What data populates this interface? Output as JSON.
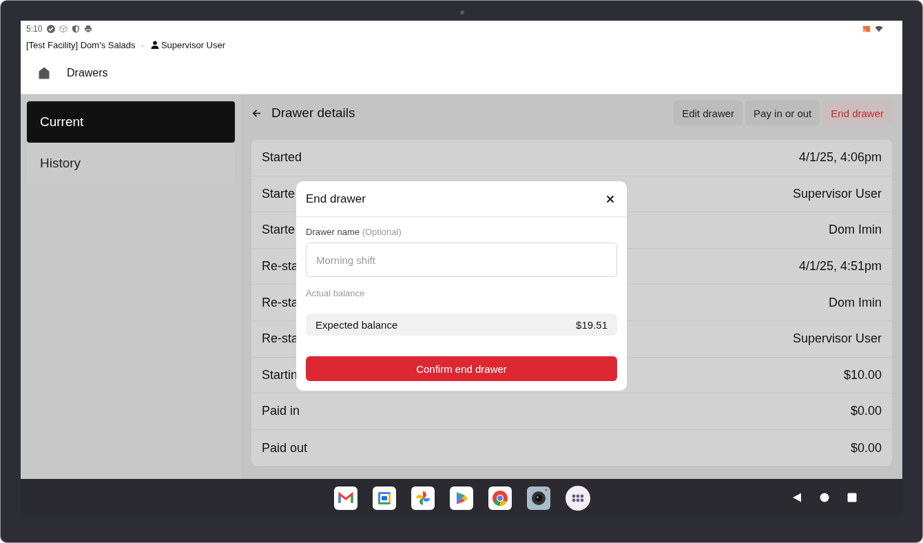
{
  "status_bar": {
    "time": "5:10"
  },
  "header": {
    "facility": "[Test Facility] Dom's Salads",
    "separator": "·",
    "user": "Supervisor User"
  },
  "app_bar": {
    "title": "Drawers"
  },
  "sidebar": {
    "items": [
      {
        "label": "Current",
        "selected": true
      },
      {
        "label": "History",
        "selected": false
      }
    ]
  },
  "detail": {
    "title": "Drawer details",
    "actions": [
      {
        "label": "Edit drawer",
        "kind": "default"
      },
      {
        "label": "Pay in or out",
        "kind": "default"
      },
      {
        "label": "End drawer",
        "kind": "danger"
      }
    ],
    "rows": [
      {
        "label": "Started",
        "value": "4/1/25, 4:06pm"
      },
      {
        "label": "Starte",
        "value": "Supervisor User"
      },
      {
        "label": "Starte",
        "value": "Dom Imin"
      },
      {
        "label": "Re-sta",
        "value": "4/1/25, 4:51pm"
      },
      {
        "label": "Re-sta",
        "value": "Dom Imin"
      },
      {
        "label": "Re-sta",
        "value": "Supervisor User"
      },
      {
        "label": "Startin",
        "value": "$10.00"
      },
      {
        "label": "Paid in",
        "value": "$0.00"
      },
      {
        "label": "Paid out",
        "value": "$0.00"
      }
    ]
  },
  "dialog": {
    "title": "End drawer",
    "field_label": "Drawer name",
    "field_hint": "(Optional)",
    "placeholder": "Morning shift",
    "section_label": "Actual balance",
    "expected": {
      "label": "Expected balance",
      "value": "$19.51"
    },
    "confirm": "Confirm end drawer"
  }
}
